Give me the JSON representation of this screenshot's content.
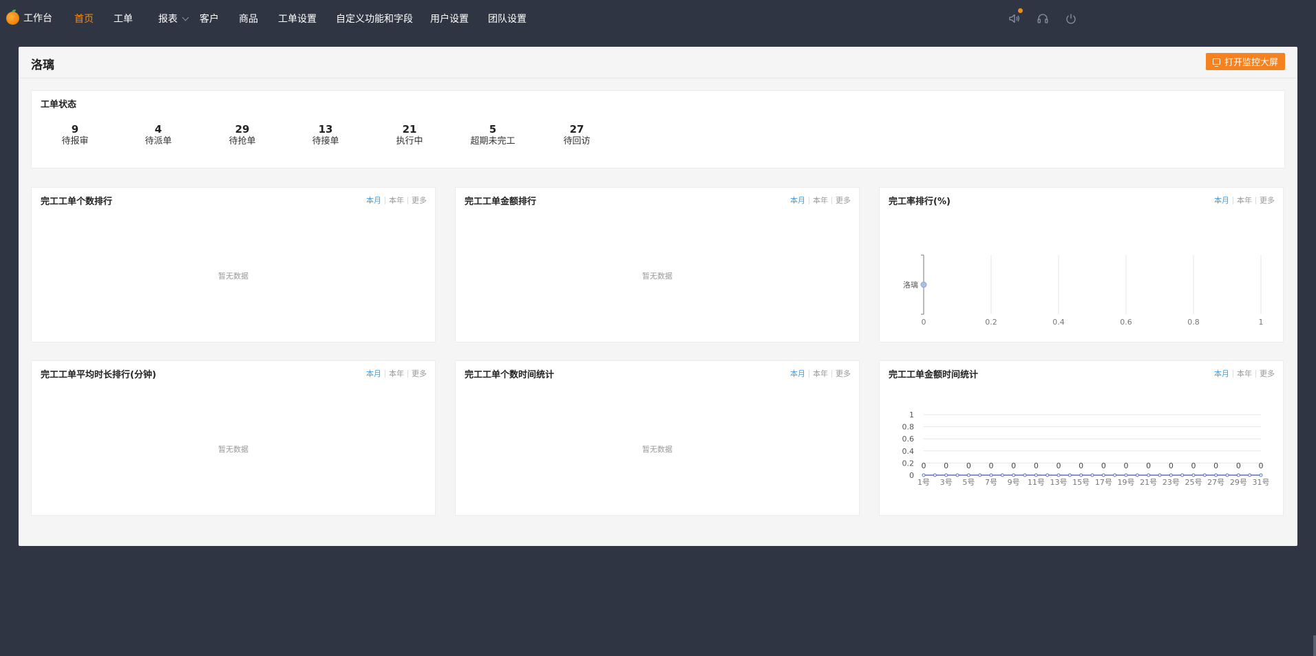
{
  "brand": {
    "name": "工作台",
    "accent": "#f08a1c"
  },
  "nav": {
    "items": [
      {
        "label": "首页",
        "active": true
      },
      {
        "label": "工单"
      },
      {
        "label": "报表",
        "dropdown": true
      },
      {
        "label": "客户"
      },
      {
        "label": "商品"
      },
      {
        "label": "工单设置"
      },
      {
        "label": "自定义功能和字段"
      },
      {
        "label": "用户设置"
      },
      {
        "label": "团队设置"
      }
    ]
  },
  "top_icons": [
    "speaker-icon",
    "headset-icon",
    "power-icon"
  ],
  "page": {
    "title": "洛璃",
    "monitor_button": "打开监控大屏"
  },
  "status": {
    "title": "工单状态",
    "items": [
      {
        "value": "9",
        "label": "待报审"
      },
      {
        "value": "4",
        "label": "待派单"
      },
      {
        "value": "29",
        "label": "待抢单"
      },
      {
        "value": "13",
        "label": "待接单"
      },
      {
        "value": "21",
        "label": "执行中"
      },
      {
        "value": "5",
        "label": "超期未完工"
      },
      {
        "value": "27",
        "label": "待回访"
      }
    ]
  },
  "period": {
    "month": "本月",
    "year": "本年",
    "more": "更多"
  },
  "no_data": "暂无数据",
  "cards": {
    "count_rank": "完工工单个数排行",
    "amount_rank": "完工工单金额排行",
    "rate_rank": "完工率排行(%)",
    "duration_rank": "完工工单平均时长排行(分钟)",
    "count_time": "完工工单个数时间统计",
    "amount_time": "完工工单金额时间统计"
  },
  "chart_data": [
    {
      "type": "scatter",
      "title": "完工率排行(%)",
      "categories": [
        "洛璃"
      ],
      "values": [
        0
      ],
      "xlim": [
        0,
        1
      ],
      "x_ticks": [
        "0",
        "0.2",
        "0.4",
        "0.6",
        "0.8",
        "1"
      ],
      "grid": true
    },
    {
      "type": "line",
      "title": "完工工单金额时间统计",
      "x": [
        "1号",
        "2号",
        "3号",
        "4号",
        "5号",
        "6号",
        "7号",
        "8号",
        "9号",
        "10号",
        "11号",
        "12号",
        "13号",
        "14号",
        "15号",
        "16号",
        "17号",
        "18号",
        "19号",
        "20号",
        "21号",
        "22号",
        "23号",
        "24号",
        "25号",
        "26号",
        "27号",
        "28号",
        "29号",
        "30号",
        "31号"
      ],
      "x_tick_labels": [
        "1号",
        "3号",
        "5号",
        "7号",
        "9号",
        "11号",
        "13号",
        "15号",
        "17号",
        "19号",
        "21号",
        "23号",
        "25号",
        "27号",
        "29号",
        "31号"
      ],
      "values": [
        0,
        0,
        0,
        0,
        0,
        0,
        0,
        0,
        0,
        0,
        0,
        0,
        0,
        0,
        0,
        0,
        0,
        0,
        0,
        0,
        0,
        0,
        0,
        0,
        0,
        0,
        0,
        0,
        0,
        0,
        0
      ],
      "ylim": [
        0,
        1
      ],
      "y_ticks": [
        "0",
        "0.2",
        "0.4",
        "0.6",
        "0.8",
        "1"
      ],
      "grid": true
    }
  ]
}
